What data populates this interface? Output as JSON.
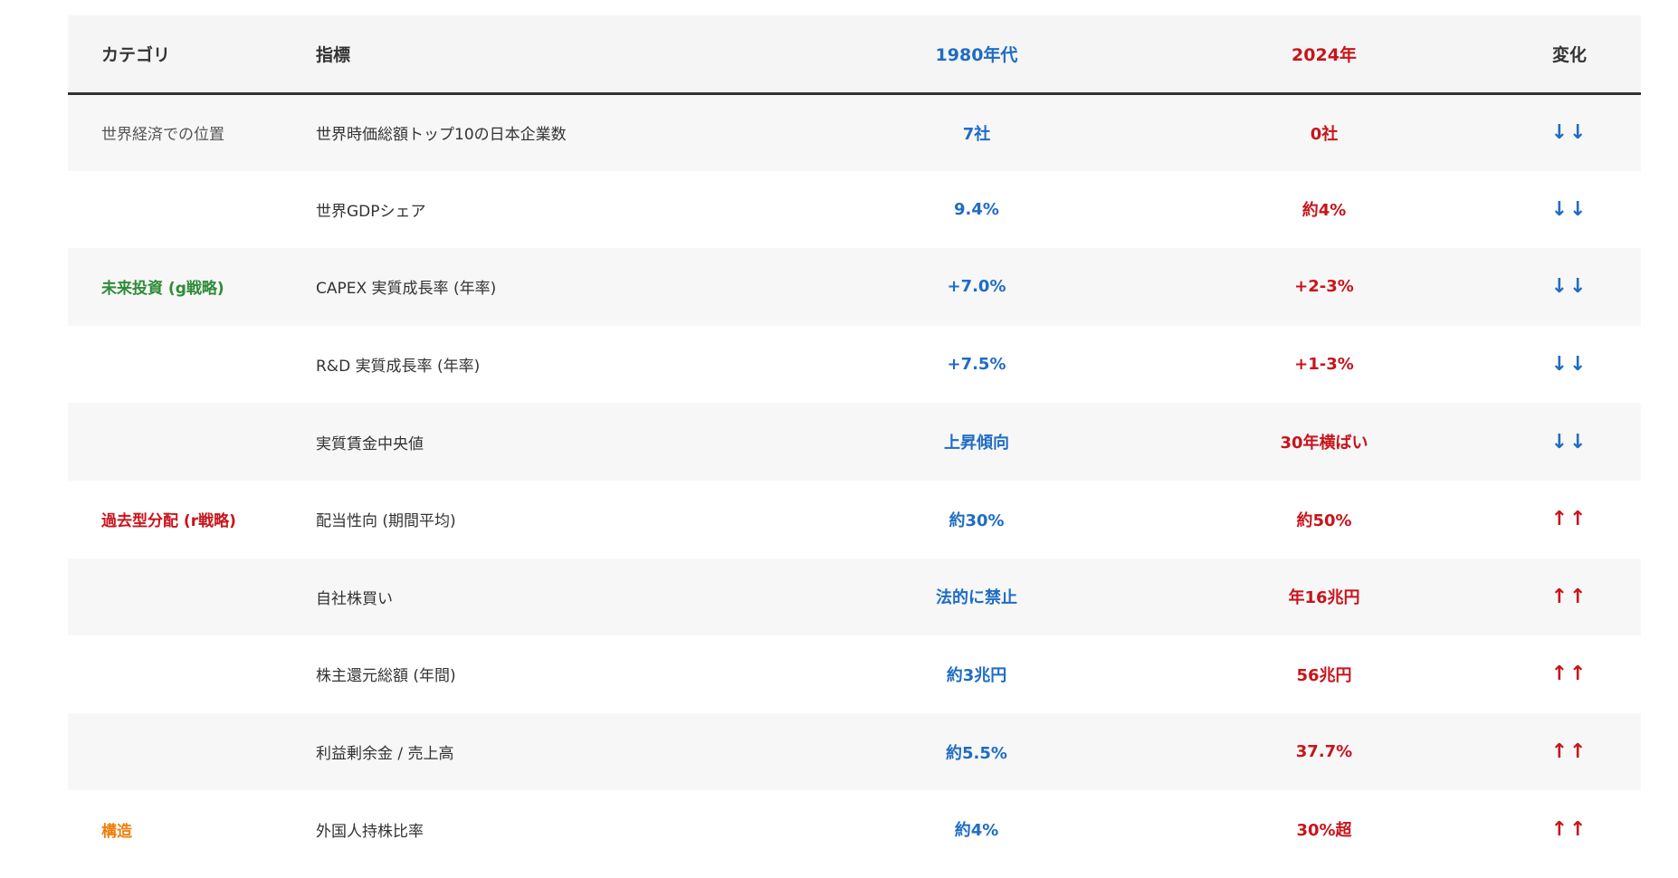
{
  "header": {
    "category": "カテゴリ",
    "indicator": "指標",
    "era_old": "1980年代",
    "era_new": "2024年",
    "change": "変化"
  },
  "colors": {
    "blue": "#1f6cc4",
    "red": "#c8141b",
    "green": "#2e8b3a",
    "orange": "#f07e0a"
  },
  "rows": [
    {
      "category": "世界経済での位置",
      "indicator": "世界時価総額トップ10の日本企業数",
      "old": "7社",
      "new": "0社",
      "change": "↓↓"
    },
    {
      "category": "",
      "indicator": "世界GDPシェア",
      "old": "9.4%",
      "new": "約4%",
      "change": "↓↓"
    },
    {
      "category": "未来投資 (g戦略)",
      "indicator": "CAPEX 実質成長率 (年率)",
      "old": "+7.0%",
      "new": "+2-3%",
      "change": "↓↓"
    },
    {
      "category": "",
      "indicator": "R&D 実質成長率 (年率)",
      "old": "+7.5%",
      "new": "+1-3%",
      "change": "↓↓"
    },
    {
      "category": "",
      "indicator": "実質賃金中央値",
      "old": "上昇傾向",
      "new": "30年横ばい",
      "change": "↓↓"
    },
    {
      "category": "過去型分配 (r戦略)",
      "indicator": "配当性向 (期間平均)",
      "old": "約30%",
      "new": "約50%",
      "change": "↑↑"
    },
    {
      "category": "",
      "indicator": "自社株買い",
      "old": "法的に禁止",
      "new": "年16兆円",
      "change": "↑↑"
    },
    {
      "category": "",
      "indicator": "株主還元総額 (年間)",
      "old": "約3兆円",
      "new": "56兆円",
      "change": "↑↑"
    },
    {
      "category": "",
      "indicator": "利益剰余金 / 売上高",
      "old": "約5.5%",
      "new": "37.7%",
      "change": "↑↑"
    },
    {
      "category": "構造",
      "indicator": "外国人持株比率",
      "old": "約4%",
      "new": "30%超",
      "change": "↑↑"
    }
  ]
}
